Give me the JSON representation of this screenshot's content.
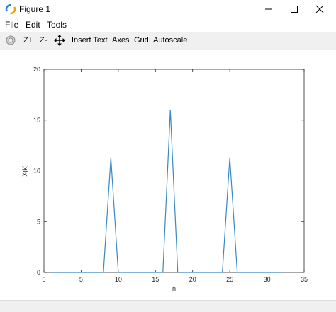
{
  "window": {
    "title": "Figure 1"
  },
  "menu": {
    "file": "File",
    "edit": "Edit",
    "tools": "Tools"
  },
  "toolbar": {
    "rotate_icon": "rotate-icon",
    "zoom_in": "Z+",
    "zoom_out": "Z-",
    "pan_icon": "pan-arrows-icon",
    "insert_text": "Insert Text",
    "axes": "Axes",
    "grid": "Grid",
    "autoscale": "Autoscale"
  },
  "colors": {
    "line": "#3a88c4",
    "axes": "#262626",
    "toolbar_bg": "#f0f0f0"
  },
  "chart_data": {
    "type": "line",
    "title": "",
    "xlabel": "n",
    "ylabel": "X(k)",
    "xlim": [
      0,
      35
    ],
    "ylim": [
      0,
      20
    ],
    "xticks": [
      0,
      5,
      10,
      15,
      20,
      25,
      30,
      35
    ],
    "yticks": [
      0,
      5,
      10,
      15,
      20
    ],
    "grid": false,
    "series": [
      {
        "x": [
          1,
          2,
          3,
          4,
          5,
          6,
          7,
          8,
          9,
          10,
          11,
          12,
          13,
          14,
          15,
          16,
          17,
          18,
          19,
          20,
          21,
          22,
          23,
          24,
          25,
          26,
          27,
          28,
          29,
          30,
          31,
          32
        ],
        "y": [
          0,
          0,
          0,
          0,
          0,
          0,
          0,
          0,
          11.3,
          0,
          0,
          0,
          0,
          0,
          0,
          0,
          16,
          0,
          0,
          0,
          0,
          0,
          0,
          0,
          11.3,
          0,
          0,
          0,
          0,
          0,
          0,
          0
        ]
      }
    ]
  }
}
